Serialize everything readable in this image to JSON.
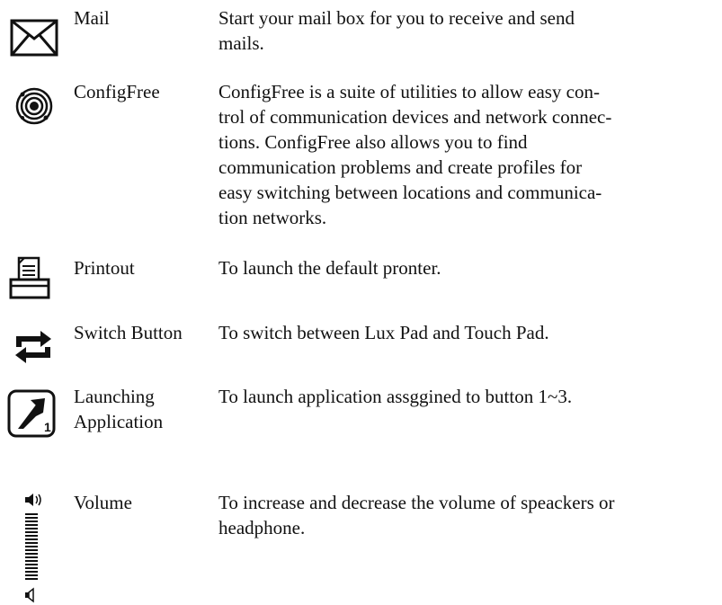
{
  "entries": [
    {
      "icon": "mail-envelope-icon",
      "name": "Mail",
      "description": [
        "Start your mail box for you to receive and send",
        "mails."
      ]
    },
    {
      "icon": "configfree-rings-icon",
      "name": "ConfigFree",
      "description": [
        "ConfigFree is a suite of utilities to allow easy con-",
        "trol of communication devices and network connec-",
        "tions. ConfigFree also allows you to find",
        "communication problems and create profiles for",
        "easy switching between locations and communica-",
        "tion networks."
      ]
    },
    {
      "icon": "printer-icon",
      "name": "Printout",
      "description": [
        "To launch the default pronter."
      ]
    },
    {
      "icon": "switch-arrows-icon",
      "name": "Switch Button",
      "description": [
        "To switch between Lux Pad and Touch Pad."
      ]
    },
    {
      "icon": "launch-application-icon",
      "icon_label": "1",
      "name_lines": [
        "Launching",
        "Application"
      ],
      "description": [
        "To launch application assggined to button 1~3."
      ]
    },
    {
      "icon": "volume-slider-icon",
      "name": "Volume",
      "description": [
        "To increase and decrease the volume of speackers or",
        "headphone."
      ]
    }
  ]
}
